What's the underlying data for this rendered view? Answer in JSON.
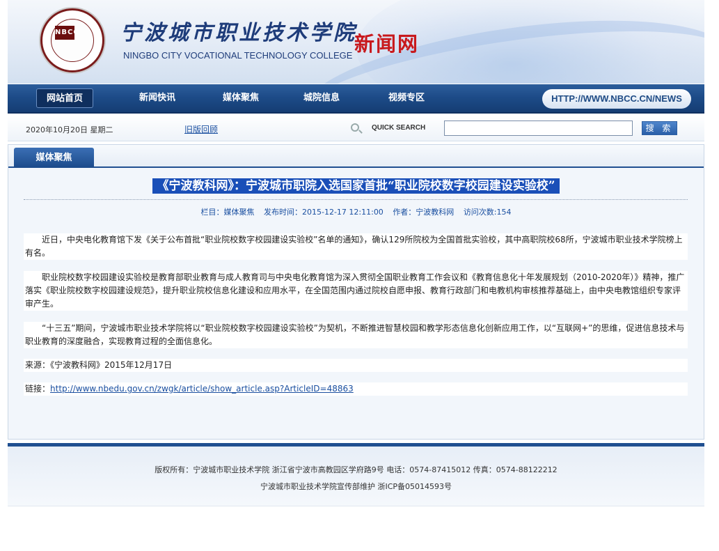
{
  "header": {
    "title_cn": "宁波城市职业技术学院",
    "title_en": "NINGBO CITY VOCATIONAL TECHNOLOGY COLLEGE",
    "subtitle": "新闻网",
    "logo_text": "NBCC"
  },
  "nav": {
    "items": [
      {
        "label": "网站首页"
      },
      {
        "label": "新闻快讯"
      },
      {
        "label": "媒体聚焦"
      },
      {
        "label": "城院信息"
      },
      {
        "label": "视频专区"
      }
    ],
    "url": "HTTP://WWW.NBCC.CN/NEWS"
  },
  "topbar": {
    "date": "2020年10月20日 星期二",
    "old_version": "旧版回顾",
    "quick_search": "QUICK SEARCH",
    "search_value": "",
    "search_button": "搜 索",
    "search_icon": "magnifier-icon"
  },
  "section": {
    "tab": "媒体聚焦"
  },
  "article": {
    "title": "《宁波教科网》：宁波城市职院入选国家首批“职业院校数字校园建设实验校”",
    "meta": {
      "column": "栏目：媒体聚焦",
      "published": "发布时间：2015-12-17 12:11:00",
      "author": "作者：宁波教科网",
      "views": "访问次数:154"
    },
    "paragraphs": [
      "近日，中央电化教育馆下发《关于公布首批“职业院校数字校园建设实验校”名单的通知》，确认129所院校为全国首批实验校，其中高职院校68所，宁波城市职业技术学院榜上有名。",
      "职业院校数字校园建设实验校是教育部职业教育与成人教育司与中央电化教育馆为深入贯彻全国职业教育工作会议和《教育信息化十年发展规划（2010-2020年）》精神，推广落实《职业院校数字校园建设规范》，提升职业院校信息化建设和应用水平，在全国范围内通过院校自愿申报、教育行政部门和电教机构审核推荐基础上，由中央电教馆组织专家评审产生。",
      "“十三五”期间，宁波城市职业技术学院将以“职业院校数字校园建设实验校”为契机，不断推进智慧校园和教学形态信息化创新应用工作，以“互联网+”的思维，促进信息技术与职业教育的深度融合，实现教育过程的全面信息化。"
    ],
    "source": "来源：《宁波教科网》2015年12月17日",
    "link_label": "链接：",
    "link_url": "http://www.nbedu.gov.cn/zwgk/article/show_article.asp?ArticleID=48863"
  },
  "footer": {
    "line1": "版权所有：宁波城市职业技术学院 浙江省宁波市高教园区学府路9号 电话：0574-87415012 传真：0574-88122212",
    "line2": "宁波城市职业技术学院宣传部维护 浙ICP备05014593号"
  }
}
